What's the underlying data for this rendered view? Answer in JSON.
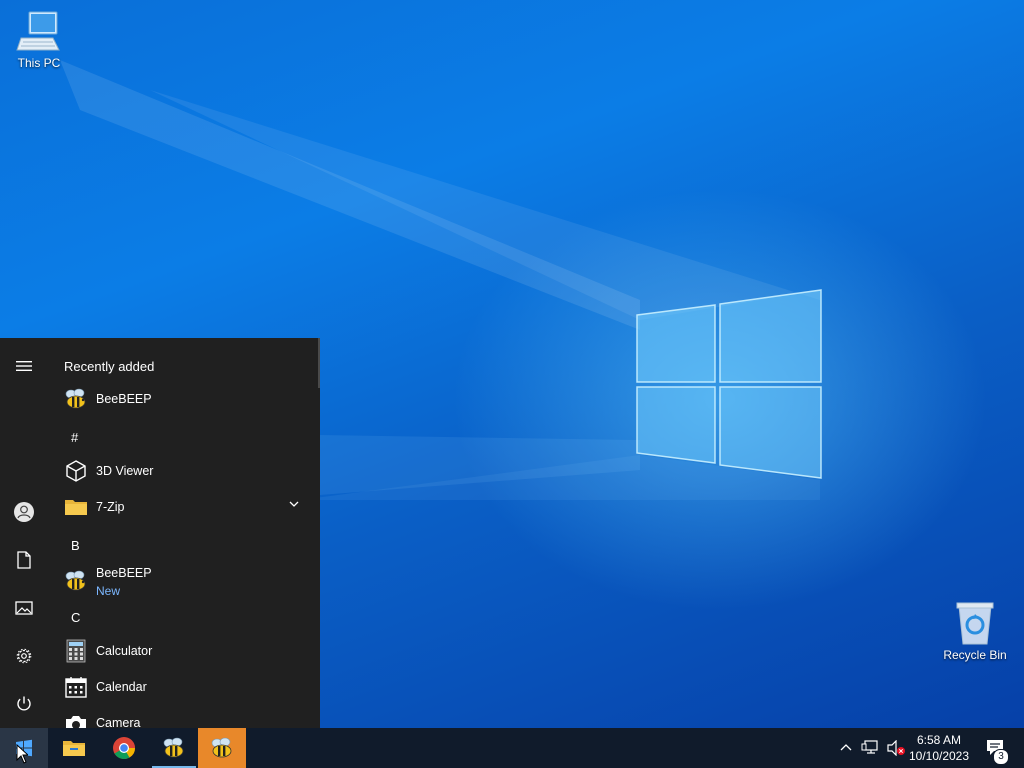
{
  "desktop": {
    "icons": [
      {
        "label": "This PC"
      },
      {
        "label": "Recycle Bin"
      }
    ]
  },
  "start_menu": {
    "recently_added_title": "Recently added",
    "recent_app": {
      "label": "BeeBEEP"
    },
    "groups": [
      {
        "letter": "#"
      },
      {
        "letter": "B"
      },
      {
        "letter": "C"
      }
    ],
    "apps": [
      {
        "label": "3D Viewer"
      },
      {
        "label": "7-Zip"
      },
      {
        "label": "BeeBEEP",
        "badge": "New"
      },
      {
        "label": "Calculator"
      },
      {
        "label": "Calendar"
      },
      {
        "label": "Camera"
      }
    ],
    "rail_icons": [
      "hamburger-menu-icon",
      "user-account-icon",
      "documents-icon",
      "pictures-icon",
      "settings-icon",
      "power-icon"
    ]
  },
  "taskbar": {
    "pinned": [
      "start-icon",
      "file-explorer-icon",
      "chrome-icon",
      "beebeep-icon",
      "beebeep-active-icon"
    ],
    "clock": {
      "time": "6:58 AM",
      "date": "10/10/2023"
    },
    "notification_count": "3"
  },
  "colors": {
    "start_bg": "#202020",
    "taskbar_bg": "#101b2b",
    "accent": "#76b9ed",
    "active_app": "#e8882a"
  }
}
